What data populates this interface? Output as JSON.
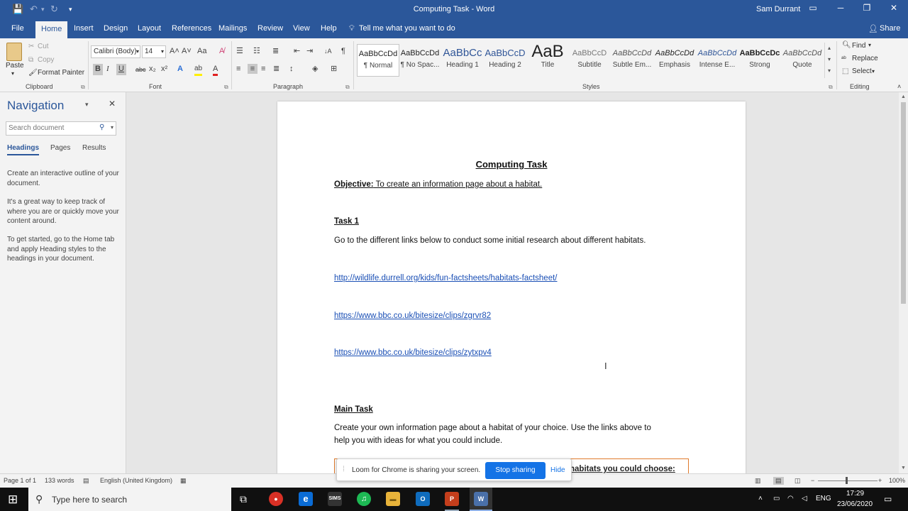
{
  "window": {
    "title": "Computing Task  -  Word",
    "user": "Sam Durrant",
    "controls": {
      "ribbon_display": "▭",
      "minimize": "─",
      "restore": "❐",
      "close": "✕"
    }
  },
  "quick_access": {
    "save": "💾",
    "undo": "↶",
    "undo_dropdown": "▾",
    "redo": "↻",
    "customize": "▾"
  },
  "tabs": [
    "File",
    "Home",
    "Insert",
    "Design",
    "Layout",
    "References",
    "Mailings",
    "Review",
    "View",
    "Help"
  ],
  "tell_me": "Tell me what you want to do",
  "share": "Share",
  "clipboard": {
    "paste": "Paste",
    "cut": "Cut",
    "copy": "Copy",
    "format_painter": "Format Painter",
    "label": "Clipboard"
  },
  "font": {
    "name": "Calibri (Body)",
    "size": "14",
    "label": "Font",
    "bold": "B",
    "italic": "I",
    "underline": "U",
    "strikethrough": "abc",
    "subscript": "x₂",
    "superscript": "x²",
    "grow": "A˄",
    "shrink": "A˅",
    "change_case": "Aa",
    "clear": "A̸",
    "text_effects": "A",
    "highlight": "ab",
    "font_color": "A"
  },
  "paragraph": {
    "label": "Paragraph",
    "show_marks": "¶",
    "sort": "↓A"
  },
  "styles": {
    "label": "Styles",
    "items": [
      {
        "preview": "AaBbCcDd",
        "name": "¶ Normal"
      },
      {
        "preview": "AaBbCcDd",
        "name": "¶ No Spac..."
      },
      {
        "preview": "AaBbCc",
        "name": "Heading 1"
      },
      {
        "preview": "AaBbCcD",
        "name": "Heading 2"
      },
      {
        "preview": "AaB",
        "name": "Title"
      },
      {
        "preview": "AaBbCcD",
        "name": "Subtitle"
      },
      {
        "preview": "AaBbCcDd",
        "name": "Subtle Em..."
      },
      {
        "preview": "AaBbCcDd",
        "name": "Emphasis"
      },
      {
        "preview": "AaBbCcDd",
        "name": "Intense E..."
      },
      {
        "preview": "AaBbCcDc",
        "name": "Strong"
      },
      {
        "preview": "AaBbCcDd",
        "name": "Quote"
      }
    ]
  },
  "editing": {
    "find": "Find",
    "replace": "Replace",
    "select": "Select",
    "label": "Editing"
  },
  "navigation": {
    "title": "Navigation",
    "search_placeholder": "Search document",
    "tabs": [
      "Headings",
      "Pages",
      "Results"
    ],
    "paragraphs": [
      "Create an interactive outline of your document.",
      "It's a great way to keep track of where you are or quickly move your content around.",
      "To get started, go to the Home tab and apply Heading styles to the headings in your document."
    ]
  },
  "document": {
    "title": "Computing Task",
    "objective_label": "Objective:",
    "objective_text": " To create an information page about a habitat.",
    "task1_heading": "Task 1",
    "task1_text": "Go to the different links below to conduct some initial research about different habitats.",
    "links": [
      "http://wildlife.durrell.org/kids/fun-factsheets/habitats-factsheet/",
      "https://www.bbc.co.uk/bitesize/clips/zgrvr82",
      "https://www.bbc.co.uk/bitesize/clips/zytxpv4"
    ],
    "main_heading": "Main Task",
    "main_text_1": "Create your own information page about a habitat of your choice. Use the links above to",
    "main_text_2": "help you with ideas for what you could include.",
    "box_text": "habitats you could choose:"
  },
  "status_bar": {
    "page": "Page 1 of 1",
    "words": "133 words",
    "language": "English (United Kingdom)",
    "zoom": "100%"
  },
  "loom": {
    "message": "Loom for Chrome is sharing your screen.",
    "stop": "Stop sharing",
    "hide": "Hide"
  },
  "taskbar": {
    "search_placeholder": "Type here to search",
    "apps": [
      {
        "name": "Chrome",
        "glyph": "●",
        "color": "#d93025"
      },
      {
        "name": "Edge",
        "glyph": "e",
        "color": "#0a6cd6"
      },
      {
        "name": "SIMS",
        "glyph": "SIMS",
        "color": "#333333"
      },
      {
        "name": "Spotify",
        "glyph": "♫",
        "color": "#1db954"
      },
      {
        "name": "File Explorer",
        "glyph": "▬",
        "color": "#e8b33a"
      },
      {
        "name": "Outlook",
        "glyph": "O",
        "color": "#0f6cbd"
      },
      {
        "name": "PowerPoint",
        "glyph": "P",
        "color": "#c43e1c"
      },
      {
        "name": "Word",
        "glyph": "W",
        "color": "#2b579a"
      }
    ],
    "language": "ENG",
    "time": "17:29",
    "date": "23/06/2020"
  },
  "colors": {
    "accent": "#2b579a",
    "link": "#1a4fb5",
    "loom_button": "#1473e6",
    "box_border": "#e07b2c"
  }
}
